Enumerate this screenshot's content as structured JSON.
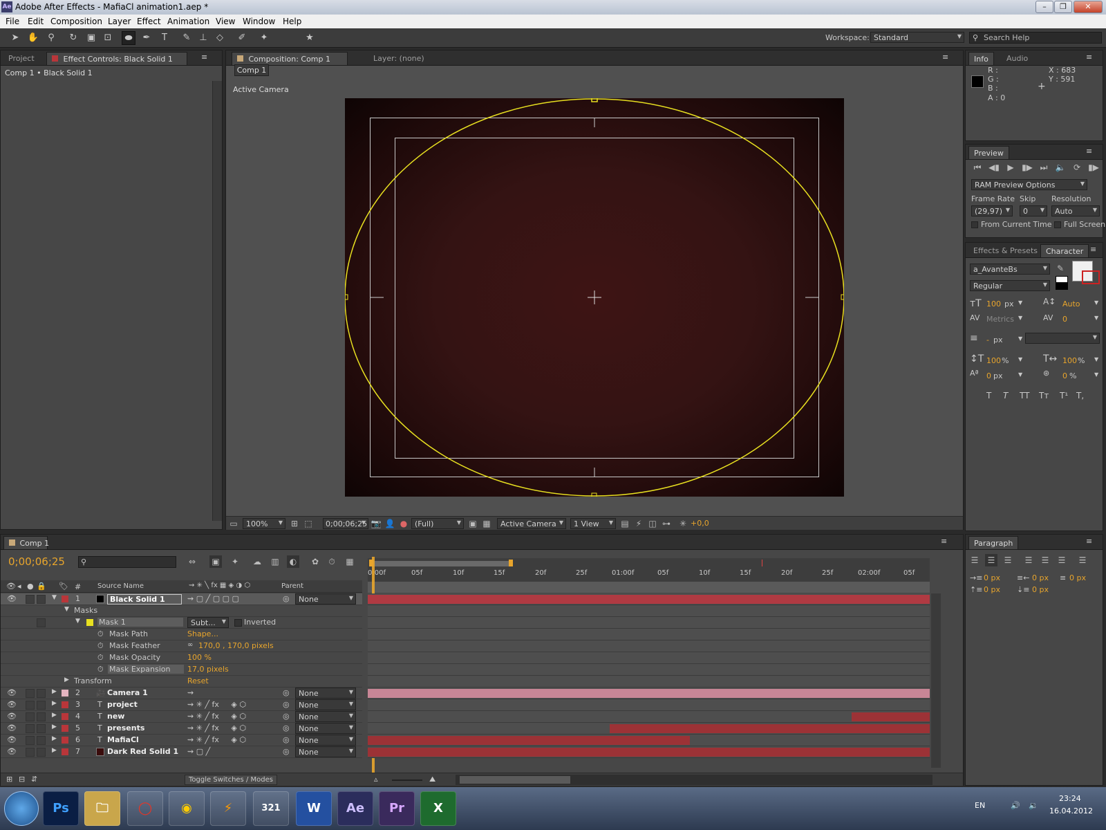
{
  "window": {
    "title": "Adobe After Effects - MafiaCl animation1.aep *",
    "app_badge": "Ae"
  },
  "menu": [
    "File",
    "Edit",
    "Composition",
    "Layer",
    "Effect",
    "Animation",
    "View",
    "Window",
    "Help"
  ],
  "toolbar": {
    "workspace_label": "Workspace:",
    "workspace_value": "Standard",
    "search_placeholder": "Search Help"
  },
  "left_panel": {
    "tab_project": "Project",
    "tab_effect": "Effect Controls: Black Solid 1",
    "breadcrumb": "Comp 1 • Black Solid 1"
  },
  "comp_panel": {
    "tab_comp": "Composition: Comp 1",
    "tab_layer": "Layer: (none)",
    "comp_button": "Comp 1",
    "camera_label": "Active Camera",
    "footer": {
      "zoom": "100%",
      "timecode": "0;00;06;25",
      "quality": "(Full)",
      "camera": "Active Camera",
      "views": "1 View",
      "exposure": "+0,0"
    }
  },
  "info_panel": {
    "tab_info": "Info",
    "tab_audio": "Audio",
    "r": "R :",
    "g": "G :",
    "b": "B :",
    "a": "A : 0",
    "x": "X : 683",
    "y": "Y : 591"
  },
  "preview_panel": {
    "tab": "Preview",
    "ram": "RAM Preview Options",
    "frame_rate_label": "Frame Rate",
    "skip_label": "Skip",
    "resolution_label": "Resolution",
    "frame_rate": "(29,97)",
    "skip": "0",
    "resolution": "Auto",
    "from_current": "From Current Time",
    "full_screen": "Full Screen"
  },
  "character_panel": {
    "tab_effects": "Effects & Presets",
    "tab_character": "Character",
    "font": "a_AvanteBs",
    "style": "Regular",
    "size": "100",
    "size_unit": "px",
    "leading": "Auto",
    "kerning": "Metrics",
    "tracking": "0",
    "stroke": "-",
    "stroke_unit": "px",
    "vscale": "100",
    "vscale_unit": "%",
    "hscale": "100",
    "hscale_unit": "%",
    "baseline": "0",
    "baseline_unit": "px",
    "tsume": "0",
    "tsume_unit": "%",
    "styles": [
      "T",
      "T",
      "TT",
      "Tт",
      "T¹",
      "T,"
    ]
  },
  "paragraph_panel": {
    "tab": "Paragraph",
    "indent_left": "0 px",
    "indent_right": "0 px",
    "indent_first": "0 px",
    "space_before": "0 px",
    "space_after": "0 px"
  },
  "timeline": {
    "tab": "Comp 1",
    "timecode": "0;00;06;25",
    "col_num": "#",
    "col_source": "Source Name",
    "col_parent": "Parent",
    "ruler": [
      "0:00f",
      "05f",
      "10f",
      "15f",
      "20f",
      "25f",
      "01:00f",
      "05f",
      "10f",
      "15f",
      "20f",
      "25f",
      "02:00f",
      "05f"
    ],
    "toggle": "Toggle Switches / Modes",
    "layers": [
      {
        "num": "1",
        "name": "Black Solid 1",
        "parent": "None",
        "color": "#b9363a"
      },
      {
        "num": "2",
        "name": "Camera 1",
        "parent": "None",
        "color": "#e4b4c0"
      },
      {
        "num": "3",
        "name": "project",
        "parent": "None",
        "color": "#b9363a"
      },
      {
        "num": "4",
        "name": "new",
        "parent": "None",
        "color": "#b9363a"
      },
      {
        "num": "5",
        "name": "presents",
        "parent": "None",
        "color": "#b9363a"
      },
      {
        "num": "6",
        "name": "MafiaCl",
        "parent": "None",
        "color": "#b9363a"
      },
      {
        "num": "7",
        "name": "Dark Red Solid 1",
        "parent": "None",
        "color": "#b9363a"
      }
    ],
    "masks_label": "Masks",
    "mask_name": "Mask 1",
    "mask_mode": "Subt...",
    "inverted": "Inverted",
    "props": [
      {
        "name": "Mask Path",
        "value": "Shape..."
      },
      {
        "name": "Mask Feather",
        "value": "170,0 , 170,0 pixels"
      },
      {
        "name": "Mask Opacity",
        "value": "100 %"
      },
      {
        "name": "Mask Expansion",
        "value": "17,0 pixels"
      }
    ],
    "transform_label": "Transform",
    "transform_value": "Reset"
  },
  "taskbar": {
    "lang": "EN",
    "time": "23:24",
    "date": "16.04.2012",
    "apps": [
      "Ps",
      "Opera",
      "Chrome",
      "Winamp",
      "321",
      "W",
      "Ae",
      "Pr",
      "X"
    ]
  }
}
